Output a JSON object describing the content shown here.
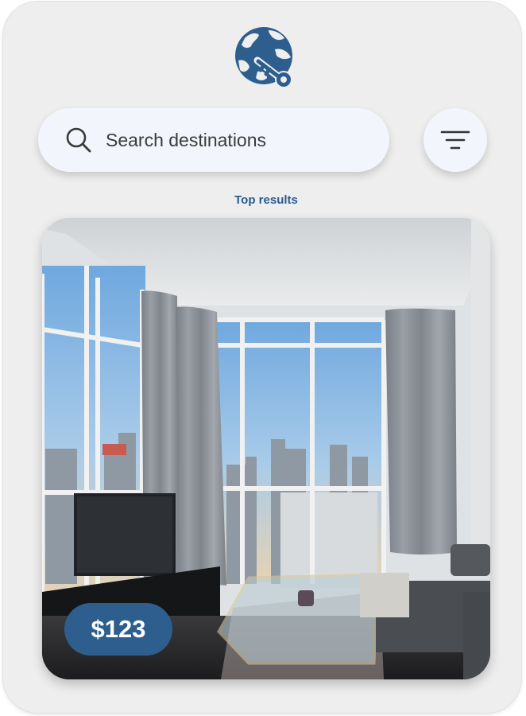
{
  "app": {
    "logo_icon": "globe-key-icon",
    "brand_color": "#2e5e8e"
  },
  "search": {
    "placeholder": "Search destinations",
    "value": "",
    "icon": "search-icon"
  },
  "filter": {
    "icon": "filter-icon"
  },
  "results": {
    "label": "Top results"
  },
  "listings": [
    {
      "price": "$123",
      "image": "living-room-city-view-photo"
    }
  ]
}
